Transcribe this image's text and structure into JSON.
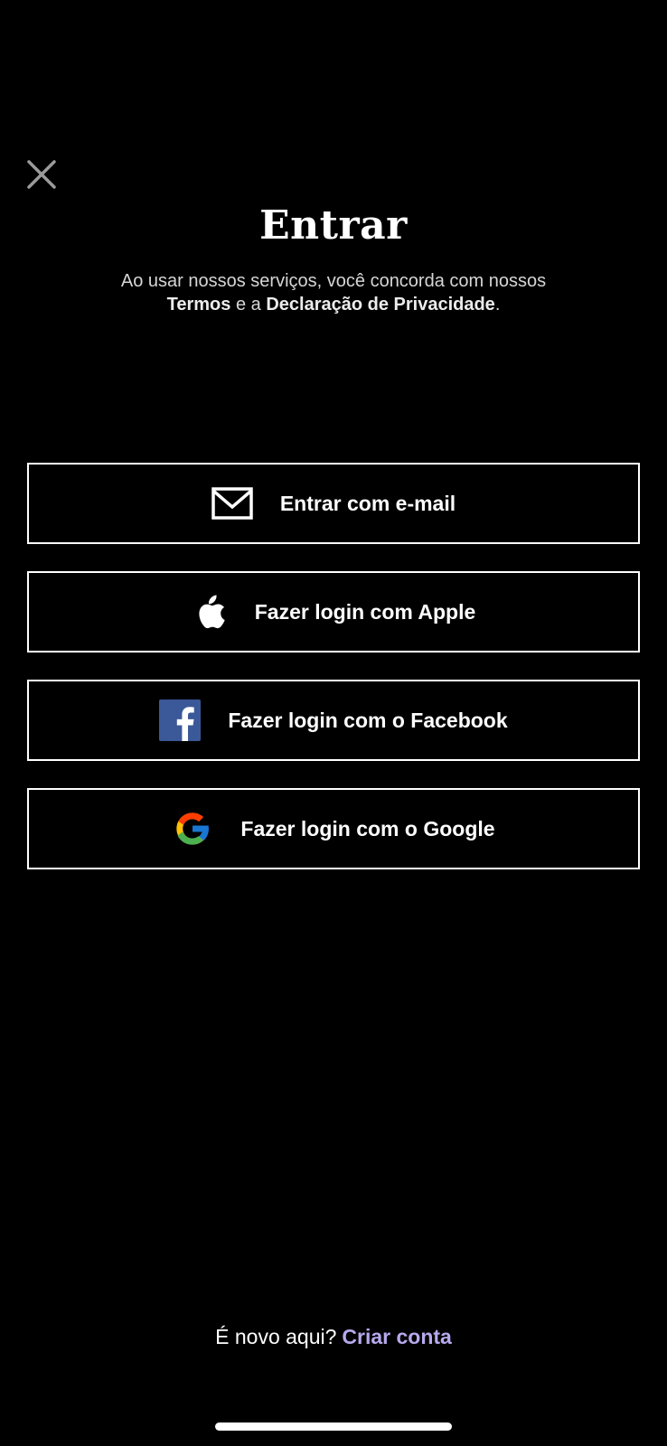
{
  "header": {
    "close_icon": "close-icon",
    "title": "Entrar"
  },
  "legal": {
    "prefix": "Ao usar nossos serviços, você concorda com nossos",
    "terms_link": "Termos",
    "connector": "e a",
    "privacy_link": "Declaração de Privacidade",
    "suffix": "."
  },
  "login_options": {
    "email": {
      "label": "Entrar com e-mail",
      "icon": "envelope-icon"
    },
    "apple": {
      "label": "Fazer login com Apple",
      "icon": "apple-icon"
    },
    "facebook": {
      "label": "Fazer login com o Facebook",
      "icon": "facebook-icon"
    },
    "google": {
      "label": "Fazer login com o Google",
      "icon": "google-icon"
    }
  },
  "footer": {
    "question": "É novo aqui?",
    "signup_link": "Criar conta"
  },
  "colors": {
    "background": "#000000",
    "text": "#ffffff",
    "accent_link": "#b7a9ec",
    "facebook_blue": "#3b5998"
  }
}
